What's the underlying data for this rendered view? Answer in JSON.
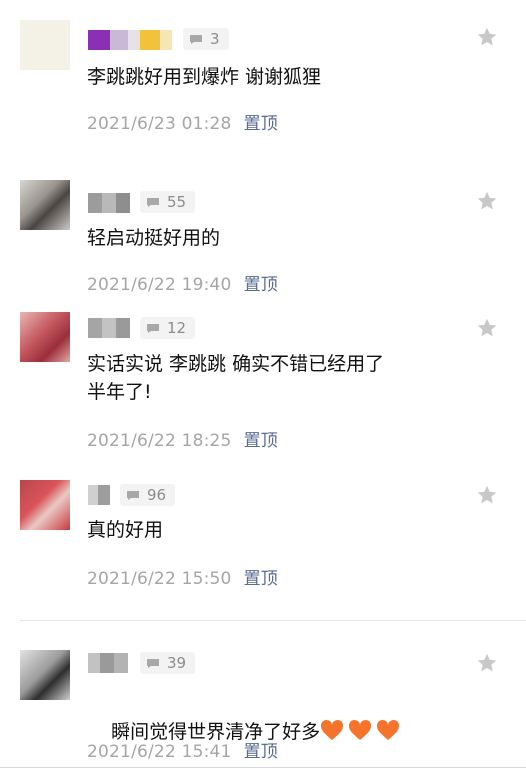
{
  "colors": {
    "pin": "#576b95",
    "meta": "#a5a5a5",
    "text": "#111111",
    "badge_bg": "#f3f3f3"
  },
  "comments": [
    {
      "count": "3",
      "text": "李跳跳好用到爆炸 谢谢狐狸",
      "time": "2021/6/23 01:28",
      "pin": "置顶"
    },
    {
      "count": "55",
      "text": "轻启动挺好用的",
      "time": "2021/6/22 19:40",
      "pin": "置顶"
    },
    {
      "count": "12",
      "text": "实话实说 李跳跳 确实不错已经用了\n半年了!",
      "time": "2021/6/22 18:25",
      "pin": "置顶"
    },
    {
      "count": "96",
      "text": "真的好用",
      "time": "2021/6/22 15:50",
      "pin": "置顶"
    },
    {
      "count": "39",
      "text": "瞬间觉得世界清净了好多",
      "time": "2021/6/22 15:41",
      "pin": "置顶",
      "emoji_icons": [
        "heart-icon",
        "heart-icon",
        "heart-icon"
      ]
    }
  ]
}
